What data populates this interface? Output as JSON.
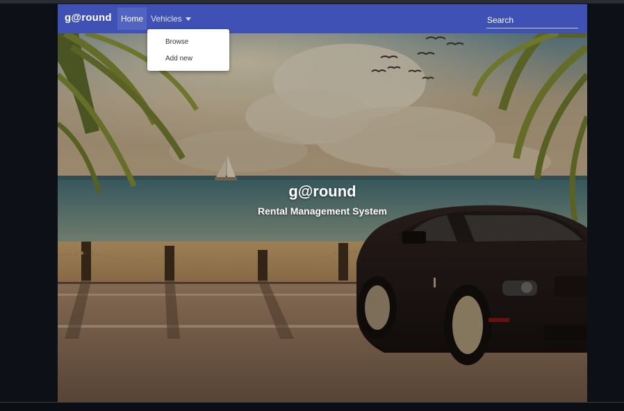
{
  "navbar": {
    "brand": "g@round",
    "home_label": "Home",
    "vehicles_label": "Vehicles",
    "search_placeholder": "Search",
    "color": "#3f51b5"
  },
  "dropdown": {
    "items": [
      {
        "label": "Browse"
      },
      {
        "label": "Add new"
      }
    ]
  },
  "hero": {
    "title": "g@round",
    "subtitle": "Rental Management System"
  }
}
